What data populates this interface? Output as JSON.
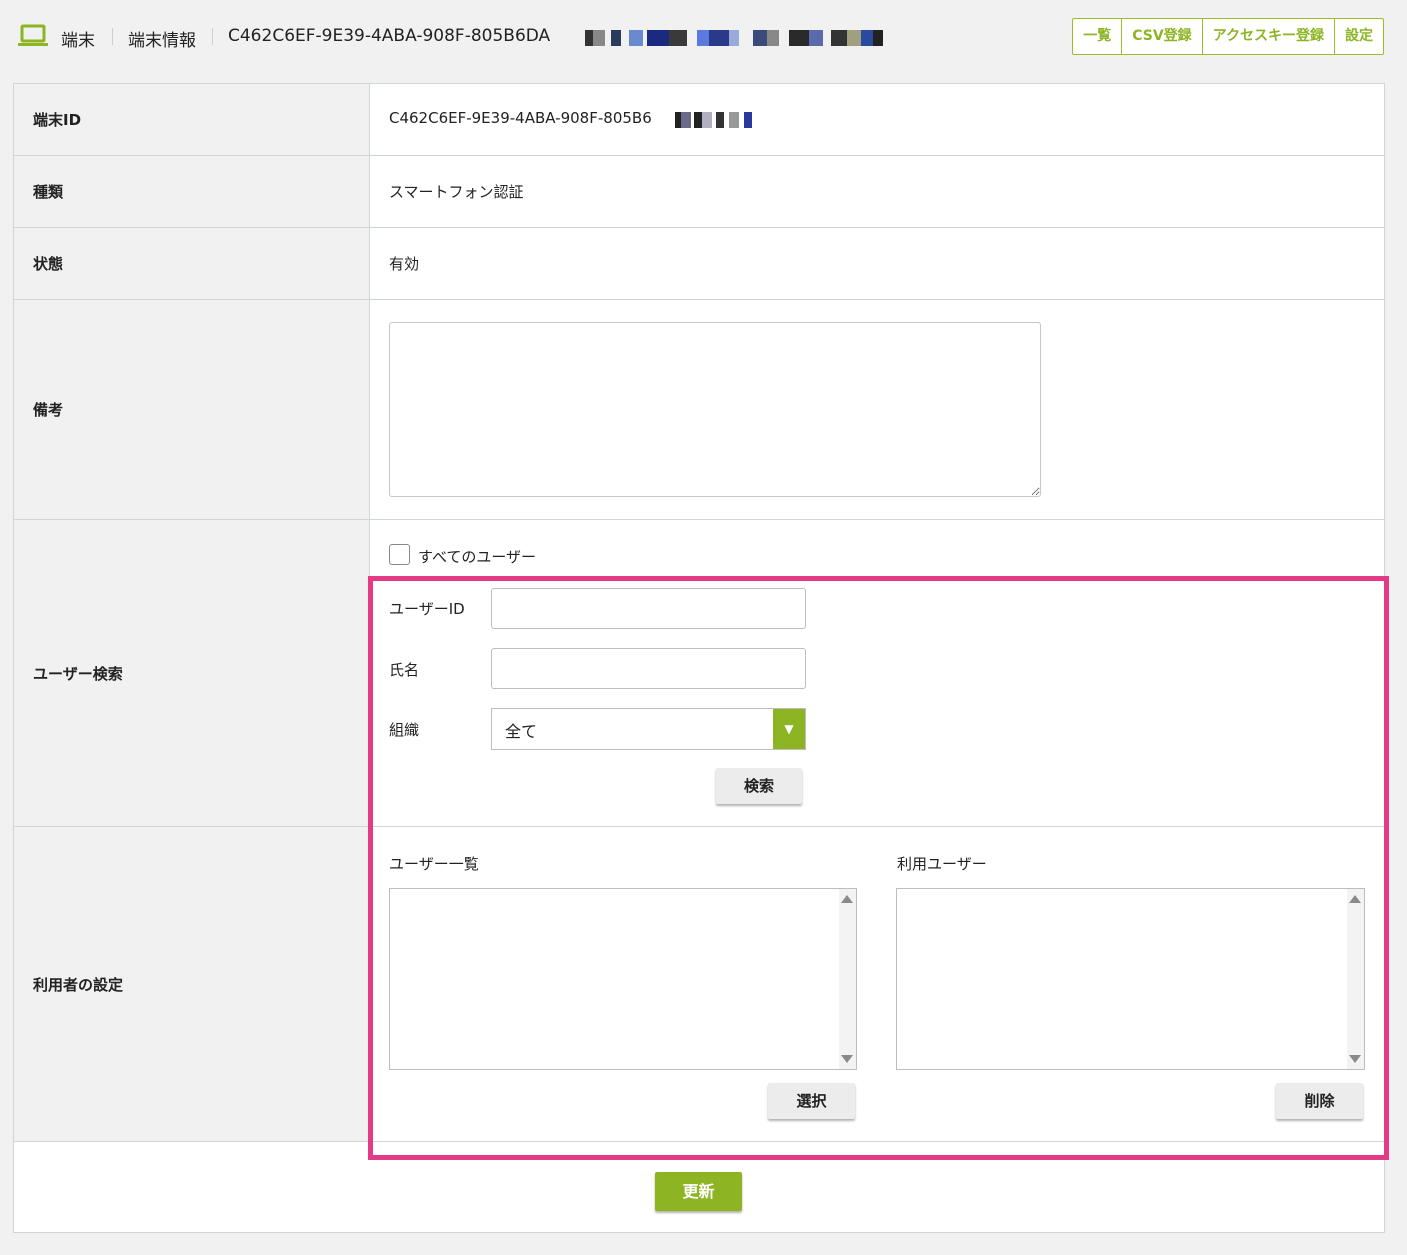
{
  "header": {
    "section": "端末",
    "page": "端末情報",
    "device_id_title": "C462C6EF-9E39-4ABA-908F-805B6DA",
    "buttons": [
      "一覧",
      "CSV登録",
      "アクセスキー登録",
      "設定"
    ]
  },
  "colors": {
    "accent": "#8db422",
    "highlight": "#e53a86"
  },
  "form": {
    "device_id_label": "端末ID",
    "device_id_value": "C462C6EF-9E39-4ABA-908F-805B6",
    "type_label": "種類",
    "type_value": "スマートフォン認証",
    "status_label": "状態",
    "status_value": "有効",
    "note_label": "備考",
    "note_value": "",
    "user_search_label": "ユーザー検索",
    "all_users_label": "すべてのユーザー",
    "all_users_checked": false,
    "user_id_label": "ユーザーID",
    "user_id_value": "",
    "name_label": "氏名",
    "name_value": "",
    "org_label": "組織",
    "org_value": "全て",
    "search_button": "検索",
    "user_settings_label": "利用者の設定",
    "user_list_title": "ユーザー一覧",
    "user_list_items": [],
    "assigned_title": "利用ユーザー",
    "assigned_items": [],
    "select_button": "選択",
    "delete_button": "削除",
    "update_button": "更新"
  }
}
